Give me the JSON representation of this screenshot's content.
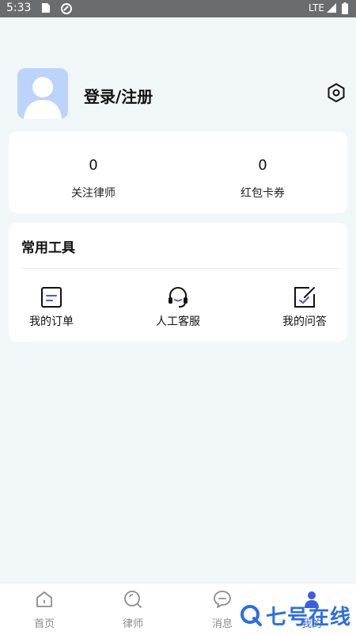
{
  "status_bar": {
    "time": "5:33",
    "network": "LTE"
  },
  "profile": {
    "login_label": "登录/注册"
  },
  "stats": [
    {
      "value": "0",
      "label": "关注律师"
    },
    {
      "value": "0",
      "label": "红包卡券"
    }
  ],
  "tools": {
    "title": "常用工具",
    "items": [
      {
        "label": "我的订单",
        "icon": "order-icon"
      },
      {
        "label": "人工客服",
        "icon": "headset-icon"
      },
      {
        "label": "我的问答",
        "icon": "qa-icon"
      }
    ]
  },
  "tabbar": {
    "items": [
      {
        "label": "首页",
        "icon": "home-icon"
      },
      {
        "label": "律师",
        "icon": "lawyer-icon"
      },
      {
        "label": "消息",
        "icon": "message-icon"
      },
      {
        "label": "我的",
        "icon": "profile-icon",
        "active": true
      }
    ]
  },
  "watermark": "七号在线",
  "colors": {
    "accent": "#3c5de0",
    "background": "#f1f6f9",
    "avatar": "#bcd3fb"
  }
}
